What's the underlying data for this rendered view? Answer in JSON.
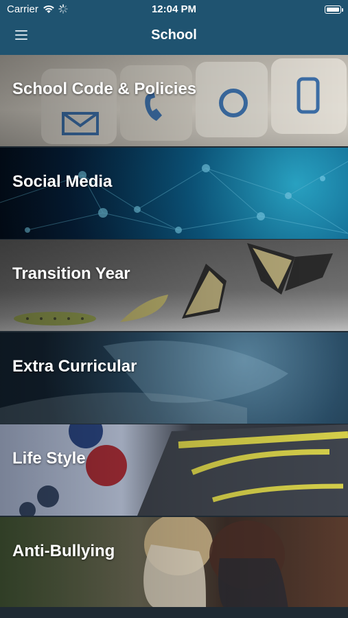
{
  "status_bar": {
    "carrier": "Carrier",
    "time": "12:04 PM"
  },
  "nav": {
    "title": "School",
    "menu_icon": "hamburger-menu-icon"
  },
  "tiles": [
    {
      "label": "School Code & Policies"
    },
    {
      "label": "Social Media"
    },
    {
      "label": "Transition Year"
    },
    {
      "label": "Extra Curricular"
    },
    {
      "label": "Life Style"
    },
    {
      "label": "Anti-Bullying"
    }
  ],
  "colors": {
    "header": "#1f5370",
    "text": "#ffffff"
  }
}
